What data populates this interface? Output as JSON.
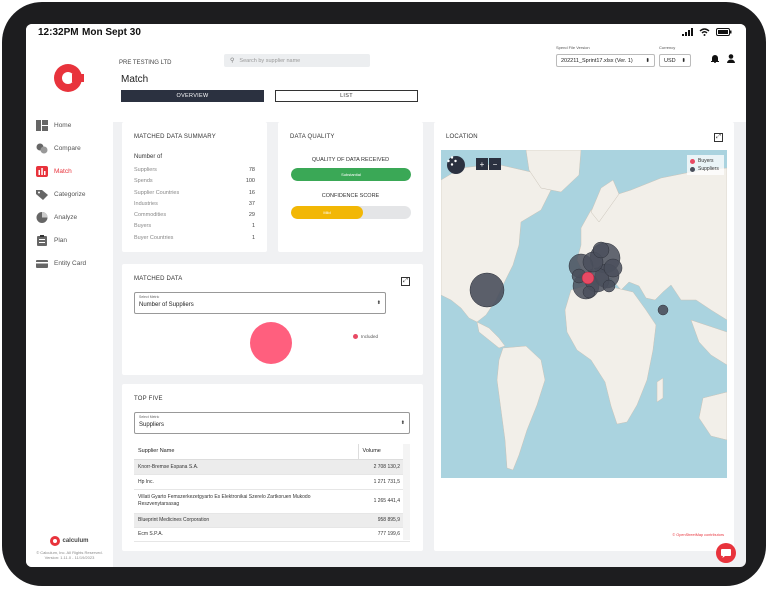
{
  "status": {
    "time": "12:32PM",
    "date": "Mon Sept 30"
  },
  "sidebar": {
    "items": [
      {
        "label": "Home",
        "icon": "home-icon"
      },
      {
        "label": "Compare",
        "icon": "compare-icon"
      },
      {
        "label": "Match",
        "icon": "match-icon",
        "active": true
      },
      {
        "label": "Categorize",
        "icon": "categorize-icon"
      },
      {
        "label": "Analyze",
        "icon": "analyze-icon"
      },
      {
        "label": "Plan",
        "icon": "plan-icon"
      },
      {
        "label": "Entity Card",
        "icon": "entity-card-icon"
      }
    ],
    "footer_logo": "calculum",
    "footer_copyright": "© Calculum, Inc. All Rights Reserved.",
    "footer_version": "Version: 1.11.0 - 11/19/2023"
  },
  "header": {
    "company": "PRE TESTING LTD",
    "title": "Match",
    "search_placeholder": "Search by supplier name",
    "tabs": {
      "overview": "OVERVIEW",
      "list": "LIST"
    },
    "spend_file_label": "Spend File Version",
    "spend_file_value": "202211_Sprint17.xlsx (Ver. 1)",
    "currency_label": "Currency",
    "currency_value": "USD"
  },
  "summary": {
    "title": "MATCHED DATA SUMMARY",
    "subtitle": "Number of",
    "rows": [
      {
        "label": "Suppliers",
        "value": "78"
      },
      {
        "label": "Spends",
        "value": "100"
      },
      {
        "label": "Supplier Countries",
        "value": "16"
      },
      {
        "label": "Industries",
        "value": "37"
      },
      {
        "label": "Commodities",
        "value": "29"
      },
      {
        "label": "Buyers",
        "value": "1"
      },
      {
        "label": "Buyer Countries",
        "value": "1"
      }
    ]
  },
  "quality": {
    "title": "DATA QUALITY",
    "received_label": "QUALITY OF DATA RECEIVED",
    "received_value": "Substantial",
    "received_level": 1.0,
    "received_color": "#3aa856",
    "confidence_label": "CONFIDENCE SCORE",
    "confidence_value": "Mild",
    "confidence_level": 0.6,
    "confidence_color": "#f2b705"
  },
  "matched": {
    "title": "MATCHED DATA",
    "select_label": "Select Metric",
    "select_value": "Number of Suppliers",
    "legend": "Included",
    "bubble_color": "#ff5f7e"
  },
  "topfive": {
    "title": "TOP FIVE",
    "select_label": "Select Metric",
    "select_value": "Suppliers",
    "columns": [
      "Supplier Name",
      "Volume"
    ],
    "rows": [
      {
        "name": "Knorr-Bremse Espana S.A.",
        "volume": "2 708 130,2"
      },
      {
        "name": "Hp Inc.",
        "volume": "1 271 731,5"
      },
      {
        "name": "Villati Gyarto Femszerkezetgyarto Es Elektronikai Szerelo Zartkoruen Mukodo Reszvenytarsasag",
        "volume": "1 265 441,4"
      },
      {
        "name": "Blueprint Medicines Corporation",
        "volume": "958 895,9"
      },
      {
        "name": "Ecm S.P.A.",
        "volume": "777 199,6"
      }
    ]
  },
  "location": {
    "title": "LOCATION",
    "legend": [
      {
        "label": "Buyers",
        "color": "#e84a64"
      },
      {
        "label": "Suppliers",
        "color": "#4a4f5c"
      }
    ],
    "attribution_sym": "©",
    "attribution": "OpenStreetMap contributors"
  }
}
